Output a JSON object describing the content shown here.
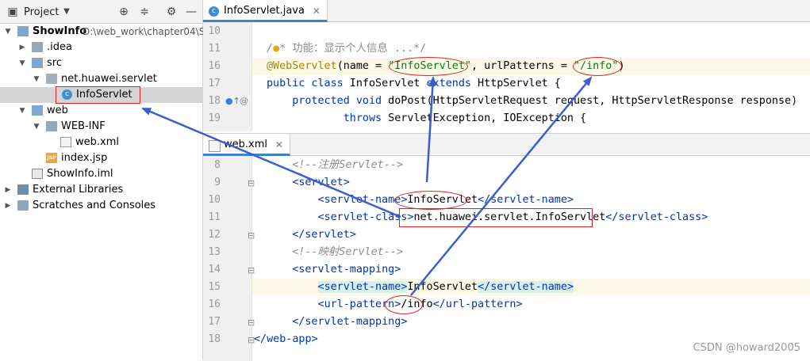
{
  "project_panel": {
    "title": "Project",
    "tree": [
      {
        "label": "ShowInfo",
        "extra": "D:\\web_work\\chapter04\\S",
        "bold": true
      },
      {
        "label": ".idea"
      },
      {
        "label": "src"
      },
      {
        "label": "net.huawei.servlet"
      },
      {
        "label": "InfoServlet",
        "selected": true
      },
      {
        "label": "web"
      },
      {
        "label": "WEB-INF"
      },
      {
        "label": "web.xml"
      },
      {
        "label": "index.jsp"
      },
      {
        "label": "ShowInfo.iml"
      },
      {
        "label": "External Libraries"
      },
      {
        "label": "Scratches and Consoles"
      }
    ]
  },
  "editor_top": {
    "tab": "InfoServlet.java",
    "lines": [
      {
        "n": "10"
      },
      {
        "n": "11"
      },
      {
        "n": "16"
      },
      {
        "n": "17"
      },
      {
        "n": "18"
      },
      {
        "n": "19"
      }
    ],
    "comment_text": "* 功能：显示个人信息 ...*/",
    "ann_name": "@WebServlet",
    "ann_open": "(name = ",
    "name_val": "\"InfoServlet\"",
    "ann_mid": ", urlPatterns = ",
    "url_val": "\"/info\"",
    "ann_close": ")",
    "l17_kw1": "public class",
    "l17_name": " InfoServlet ",
    "l17_kw2": "extends",
    "l17_rest": " HttpServlet {",
    "l18_kw": "protected void",
    "l18_rest": " doPost(HttpServletRequest request, HttpServletResponse response)",
    "l19_kw": "throws",
    "l19_rest": " ServletException, IOException {"
  },
  "editor_bottom": {
    "tab": "web.xml",
    "line_numbers": [
      "8",
      "9",
      "10",
      "11",
      "12",
      "13",
      "14",
      "15",
      "16",
      "17",
      "18"
    ],
    "l8": "<!--注册Servlet-->",
    "l13": "<!--映射Servlet-->",
    "tags": {
      "servlet": "servlet",
      "servlet_name": "servlet-name",
      "servlet_class": "servlet-class",
      "servlet_mapping": "servlet-mapping",
      "url_pattern": "url-pattern",
      "web_app": "web-app"
    },
    "servlet_name_val": "InfoServlet",
    "servlet_class_val": "net.huawei.servlet.InfoServlet",
    "mapping_name_val": "InfoServlet",
    "url_val": "/info"
  },
  "watermark": "CSDN @howard2005",
  "colors": {
    "annotation_red": "#e02020",
    "arrow_blue": "#3a5fcd"
  }
}
